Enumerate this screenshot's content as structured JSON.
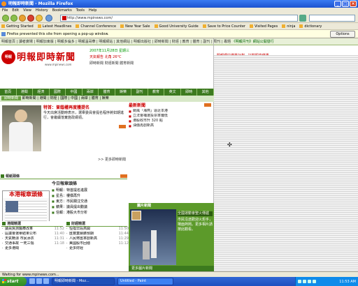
{
  "window": {
    "title": "明報即時新聞 - Mozilla Firefox"
  },
  "menubar": [
    "File",
    "Edit",
    "View",
    "History",
    "Bookmarks",
    "Tools",
    "Help"
  ],
  "nav": {
    "url": "http://www.mpinews.com/",
    "search_placeholder": ""
  },
  "bookmarks": [
    "Getting Started",
    "Latest Headlines",
    "Channel Conference",
    "New Year Sale",
    "Good University Guide",
    "Save to Price Counter",
    "Visited Pages",
    "ninja",
    "dictionary"
  ],
  "notification": {
    "text": "Firefox prevented this site from opening a pop-up window.",
    "options_label": "Options"
  },
  "page": {
    "top_stripe": "明報首頁 | 讀者廣場 | 明報加東版 | 明報多倫多 | 明報溫哥華 | 明報網站 | 其他網站 | 明報出版社 | 即時新聞 | 財經 | 教育 | 體育 | 副刊 | 周刊 | 專題",
    "top_stripe_right": "《明報月刊》網站公開發行",
    "logo_text": "明報即時新聞",
    "logo_badge": "明報",
    "logo_url": "www.mpinews.com",
    "date_line1": "2007年11月28日  星期三",
    "date_line2": "天氣報告  北角  26°C",
    "date_line3": "即時新聞  財經新聞  體育新聞",
    "right_ad": "明報網站優惠計劃 · 訂閱即享優惠",
    "nav_tabs": [
      "首頁",
      "港聞",
      "經濟",
      "國際",
      "中國",
      "兩岸",
      "體育",
      "娛樂",
      "副刊",
      "教育",
      "英文",
      "即時",
      "其他"
    ],
    "subnav": "即時新聞 | 港聞 | 財經 | 國際 | 中國 | 兩岸 | 體育 | 娛樂",
    "subnav_selected": "即時新聞",
    "headline": "特首：曾蔭權再度獲提名",
    "headline_sub": "今天出席活動時表示，選舉委員會提名程序將如期進行，會繼續落實施政綱領。",
    "more_link": ">> 更多即時新聞",
    "instant_title": "最新新聞",
    "instant_items": [
      "颱風「海燕」逼近本港",
      "立法會補選投票率偏低",
      "港股收市升 320 點",
      "油價再創新高"
    ],
    "paper_section": "報紙頭條",
    "paper_headline": "本港報章頭條",
    "today_title": "今日報章頭條",
    "today_items": [
      "明報：特首提名進展",
      "星島：樓價再升",
      "東方：市民關注交通",
      "蘋果：議員提出動議",
      "信報：港股大市分析"
    ],
    "list_left_title": "港聞精選",
    "list_right_title": "財經精選",
    "list_left": [
      {
        "t": "議員質詢醫療改革",
        "time": "11:52"
      },
      {
        "t": "區議會選舉結果公布",
        "time": "11:40"
      },
      {
        "t": "天氣轉涼 市民添衣",
        "time": "11:31"
      },
      {
        "t": "交通事故 一死三傷",
        "time": "11:18"
      },
      {
        "t": "更多港聞",
        "time": ""
      }
    ],
    "list_right": [
      {
        "t": "恒指早段高開",
        "time": "11:50"
      },
      {
        "t": "匯豐業績勝預期",
        "time": "11:44"
      },
      {
        "t": "人民幣匯率創新高",
        "time": "11:29"
      },
      {
        "t": "美國股市回穩",
        "time": "11:12"
      },
      {
        "t": "更多財經",
        "time": ""
      }
    ],
    "photo_box_title": "圖片新聞",
    "photo_box_highlight": "全國運動會聖火傳遞",
    "photo_box_text": "市民沿途歡迎火炬手，場面熱鬧。更多相片請按此觀看。",
    "photo_box_foot": "更多圖片新聞"
  },
  "statusbar": "Waiting for www.mpinews.com...",
  "taskbar": {
    "start_label": "start",
    "tasks": [
      "明報即時新聞 - Moz...",
      "Untitled - Paint"
    ],
    "clock": "11:53 AM"
  }
}
